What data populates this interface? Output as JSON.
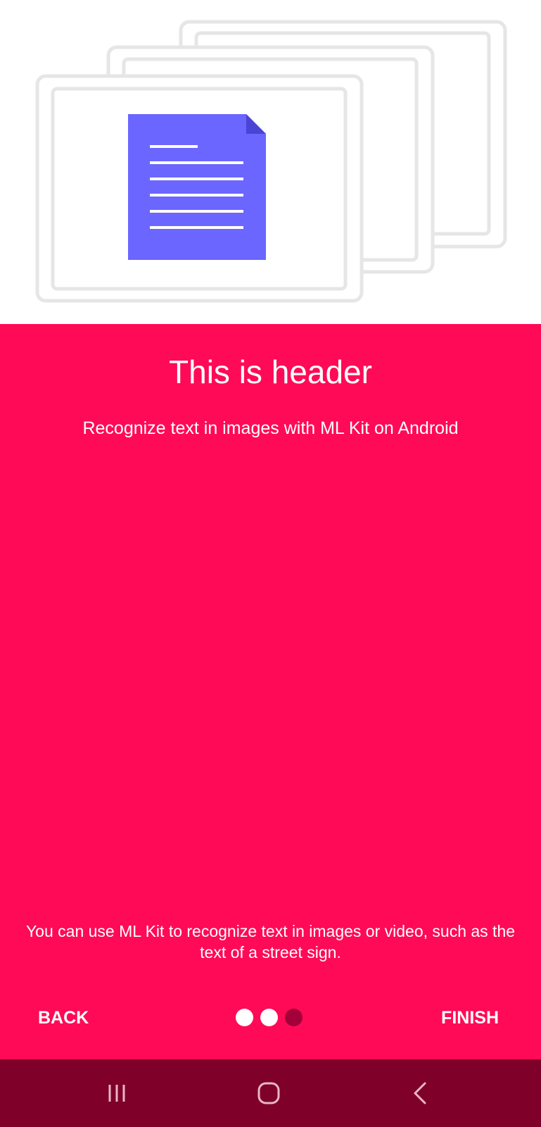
{
  "onboarding": {
    "title": "This is header",
    "subtitle": "Recognize text in images with ML Kit on Android",
    "description": "You can use ML Kit to recognize text in images or video, such as the text of a street sign."
  },
  "navigation": {
    "back_label": "BACK",
    "finish_label": "FINISH",
    "page_indicator": {
      "total": 3,
      "current": 3
    }
  },
  "system_nav": {
    "recents_icon": "recents-icon",
    "home_icon": "home-icon",
    "back_icon": "back-arrow-icon"
  },
  "colors": {
    "background": "#ff0a56",
    "system_bar": "#7f0029",
    "document": "#6b66ff",
    "card_outline": "#e6e6e6"
  }
}
